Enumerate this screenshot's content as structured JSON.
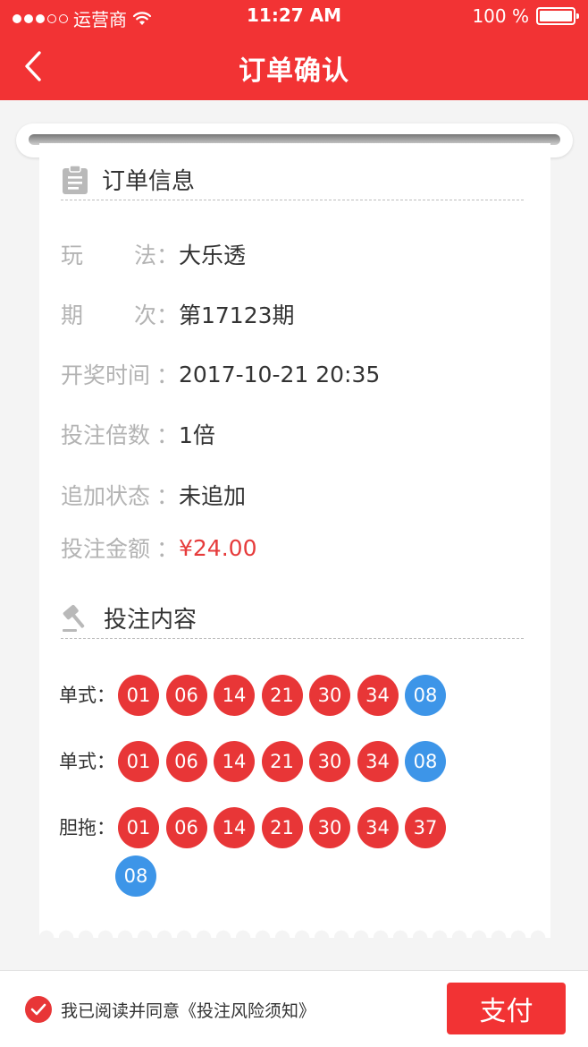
{
  "status_bar": {
    "carrier": "运营商",
    "time": "11:27 AM",
    "battery": "100 %"
  },
  "nav": {
    "title": "订单确认"
  },
  "order_info": {
    "title": "订单信息",
    "rows": [
      {
        "label": [
          "玩",
          "法",
          "："
        ],
        "value": "大乐透"
      },
      {
        "label": [
          "期",
          "次",
          "："
        ],
        "value": "第17123期"
      },
      {
        "label": [
          "开奖时间",
          "",
          "："
        ],
        "value": "2017-10-21 20:35"
      },
      {
        "label": [
          "投注倍数",
          "",
          "："
        ],
        "value": "1倍"
      },
      {
        "label": [
          "追加状态",
          "",
          "："
        ],
        "value": "未追加"
      },
      {
        "label": [
          "投注金额",
          "",
          "："
        ],
        "value": "¥24.00"
      }
    ]
  },
  "bet_content": {
    "title": "投注内容",
    "rows": [
      {
        "label": "单式：",
        "red": [
          "01",
          "06",
          "14",
          "21",
          "30",
          "34"
        ],
        "blue": [
          "08"
        ]
      },
      {
        "label": "单式：",
        "red": [
          "01",
          "06",
          "14",
          "21",
          "30",
          "34"
        ],
        "blue": [
          "08"
        ]
      },
      {
        "label": "胆拖：",
        "red": [
          "01",
          "06",
          "14",
          "21",
          "30",
          "34",
          "37"
        ],
        "blue": [
          "08"
        ]
      }
    ]
  },
  "footer": {
    "agree_text": "我已阅读并同意《投注风险须知》",
    "pay_label": "支付"
  },
  "colors": {
    "brand_red": "#f23334",
    "ball_red": "#e83637",
    "ball_blue": "#3d95e8",
    "price": "#e63b3b"
  },
  "icons": {
    "back": "chevron-left-icon",
    "order_info": "clipboard-icon",
    "bet_content": "gavel-icon",
    "agree": "check-circle-icon"
  }
}
